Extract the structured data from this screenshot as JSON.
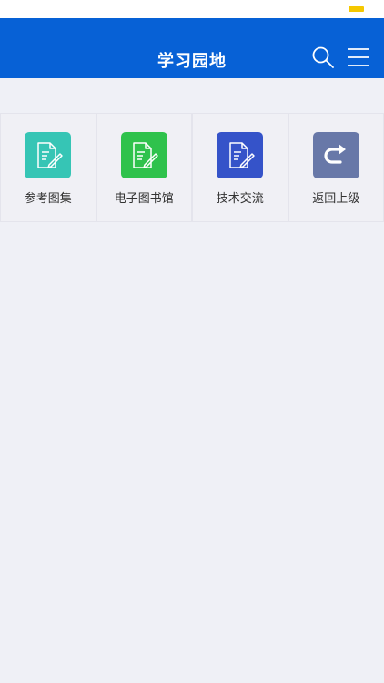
{
  "header": {
    "title": "学习园地",
    "search_icon": "search-icon",
    "menu_icon": "menu-icon",
    "background": "#0761d6"
  },
  "status_bar": {
    "battery_color": "#f5c800"
  },
  "tiles": [
    {
      "label": "参考图集",
      "icon": "document-edit-icon",
      "color": "#36c5b5"
    },
    {
      "label": "电子图书馆",
      "icon": "document-edit-icon",
      "color": "#2fc24c"
    },
    {
      "label": "技术交流",
      "icon": "document-edit-icon",
      "color": "#3553c9"
    },
    {
      "label": "返回上级",
      "icon": "return-arrow-icon",
      "color": "#6878a8"
    }
  ]
}
